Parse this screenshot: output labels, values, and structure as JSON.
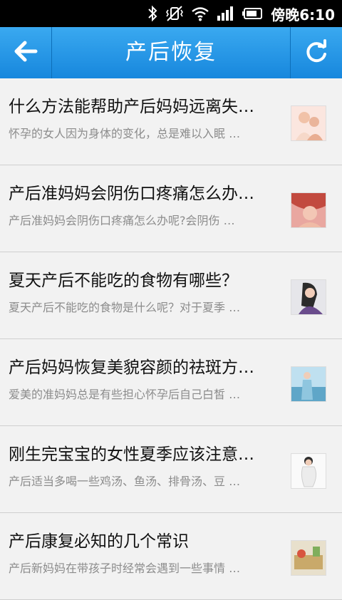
{
  "status_bar": {
    "time": "傍晚6:10",
    "icons": [
      "bluetooth-icon",
      "vibrate-mute-icon",
      "wifi-icon",
      "signal-icon",
      "battery-icon"
    ]
  },
  "header": {
    "title": "产后恢复",
    "back_icon": "back-arrow-icon",
    "refresh_icon": "refresh-icon",
    "color": "#2196e6"
  },
  "articles": [
    {
      "title": "什么方法能帮助产后妈妈远离失…",
      "summary": "怀孕的女人因为身体的变化，总是难以入眠 …"
    },
    {
      "title": "产后准妈妈会阴伤口疼痛怎么办…",
      "summary": "产后准妈妈会阴伤口疼痛怎么办呢?会阴伤 …"
    },
    {
      "title": "夏天产后不能吃的食物有哪些？",
      "summary": "夏天产后不能吃的食物是什么呢？对于夏季 …"
    },
    {
      "title": "产后妈妈恢复美貌容颜的祛斑方…",
      "summary": "爱美的准妈妈总是有些担心怀孕后自己白皙 …"
    },
    {
      "title": "刚生完宝宝的女性夏季应该注意…",
      "summary": "产后适当多喝一些鸡汤、鱼汤、排骨汤、豆 …"
    },
    {
      "title": "产后康复必知的几个常识",
      "summary": "产后新妈妈在带孩子时经常会遇到一些事情 …"
    }
  ]
}
